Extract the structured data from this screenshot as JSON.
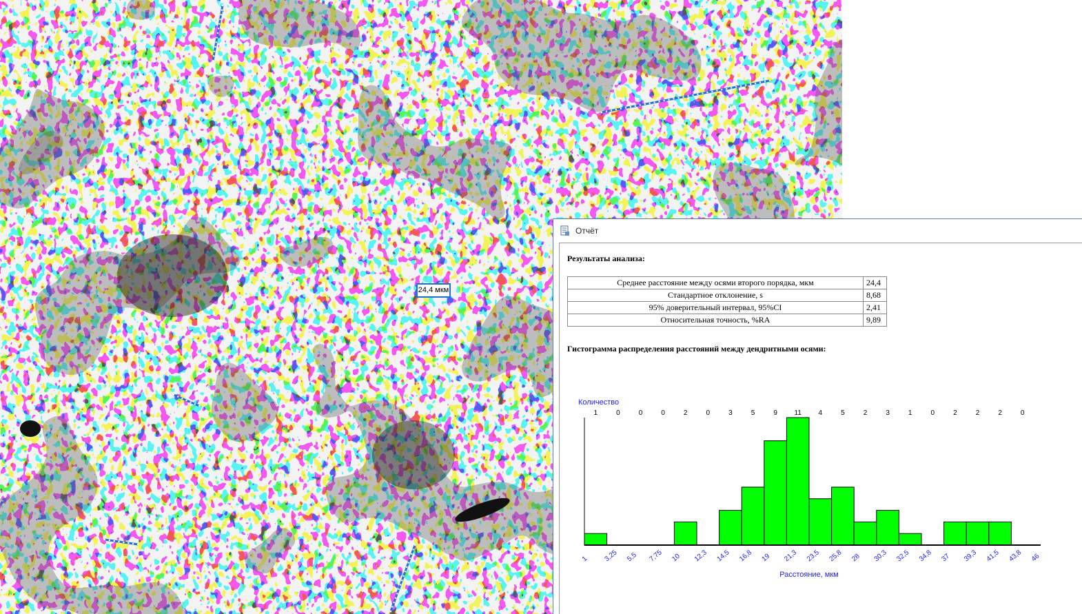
{
  "image": {
    "measurement_label": "24,4 мкм"
  },
  "report": {
    "window_title": "Отчёт",
    "results_heading": "Результаты анализа:",
    "results": [
      {
        "label": "Среднее расстояние между осями второго порядка, мкм",
        "value": "24,4"
      },
      {
        "label": "Стандартное отклонение, s",
        "value": "8,68"
      },
      {
        "label": "95% доверительный интервал, 95%CI",
        "value": "2,41"
      },
      {
        "label": "Относительная точность, %RA",
        "value": "9,89"
      }
    ],
    "histogram_heading": "Гистограмма распределения расстояний между дендритными осями:"
  },
  "chart_data": {
    "type": "bar",
    "ylabel": "Количество",
    "xlabel": "Расстояние, мкм",
    "x_ticks": [
      "1",
      "3,25",
      "5,5",
      "7,75",
      "10",
      "12,3",
      "14,5",
      "16,8",
      "19",
      "21,3",
      "23,5",
      "25,8",
      "28",
      "30,3",
      "32,5",
      "34,8",
      "37",
      "39,3",
      "41,5",
      "43,8",
      "46"
    ],
    "values": [
      1,
      0,
      0,
      0,
      2,
      0,
      3,
      5,
      9,
      11,
      4,
      5,
      2,
      3,
      1,
      0,
      2,
      2,
      2,
      0
    ],
    "ylim": [
      0,
      11
    ],
    "bar_color": "#00ff00",
    "label_color": "#1a1aff"
  },
  "colors": {
    "measure_line": "#1f6fd6",
    "measure_dot": "#ffffff"
  }
}
